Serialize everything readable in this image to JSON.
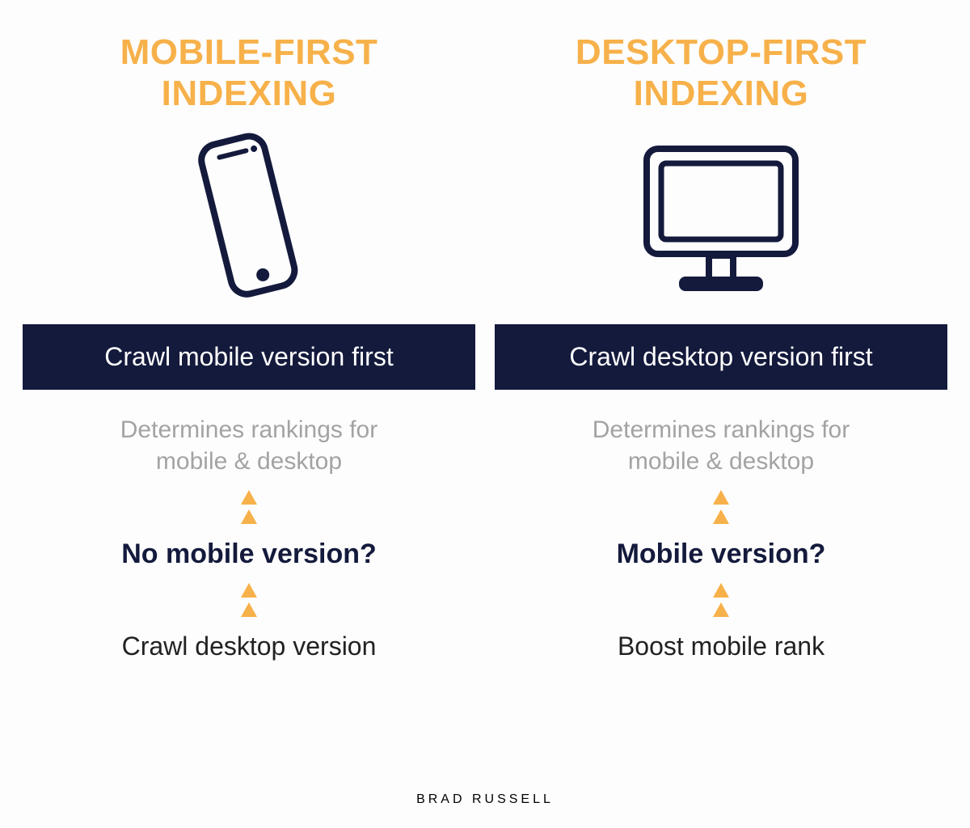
{
  "colors": {
    "accent": "#F7B14A",
    "navy": "#141A3C",
    "muted": "#A3A3A3",
    "text": "#222222"
  },
  "left": {
    "title_line1": "MOBILE-FIRST",
    "title_line2": "INDEXING",
    "banner": "Crawl mobile version first",
    "muted_line1": "Determines rankings for",
    "muted_line2": "mobile & desktop",
    "question": "No mobile version?",
    "final": "Crawl desktop version"
  },
  "right": {
    "title_line1": "DESKTOP-FIRST",
    "title_line2": "INDEXING",
    "banner": "Crawl desktop version first",
    "muted_line1": "Determines rankings for",
    "muted_line2": "mobile & desktop",
    "question": "Mobile version?",
    "final": "Boost mobile rank"
  },
  "footer": "BRAD RUSSELL"
}
